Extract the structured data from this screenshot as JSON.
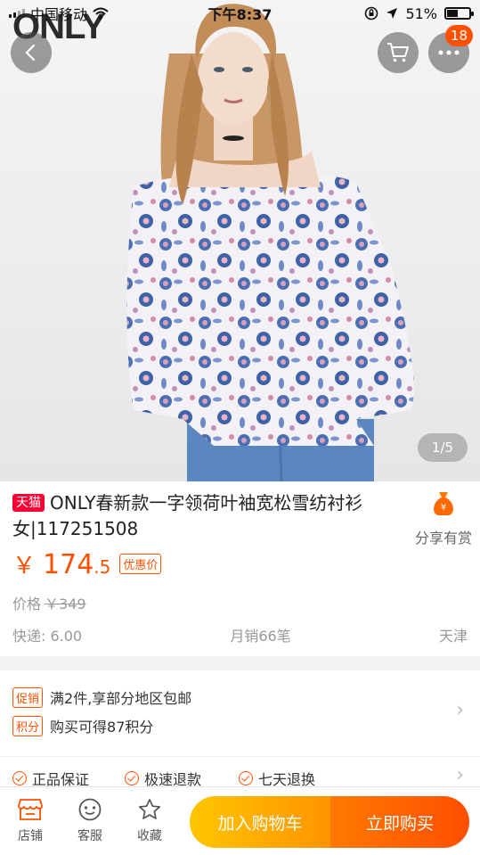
{
  "status_bar": {
    "carrier": "中国移动",
    "time": "下午8:37",
    "battery": "51%",
    "battery_level": 0.51
  },
  "hero": {
    "brand_logo": "ONLY",
    "page_indicator": "1/5",
    "cart_badge": "18"
  },
  "product": {
    "store_tag": "天猫",
    "title": "ONLY春新款一字领荷叶袖宽松雪纺衬衫女|117251508",
    "share_label": "分享有赏",
    "price_currency": "￥",
    "price_integer": "174",
    "price_decimal": ".5",
    "price_tag": "优惠价",
    "original_label": "价格",
    "original_price": "￥349",
    "shipping": "快递: 6.00",
    "monthly_sales": "月销66笔",
    "location": "天津"
  },
  "promotions": [
    {
      "tag": "促销",
      "text": "满2件,享部分地区包邮"
    },
    {
      "tag": "积分",
      "text": "购买可得87积分"
    }
  ],
  "guarantees": [
    "正品保证",
    "极速退款",
    "七天退换"
  ],
  "bottom_bar": {
    "tabs": [
      {
        "label": "店铺",
        "icon": "store-icon"
      },
      {
        "label": "客服",
        "icon": "customer-service-icon"
      },
      {
        "label": "收藏",
        "icon": "star-icon"
      }
    ],
    "add_to_cart": "加入购物车",
    "buy_now": "立即购买"
  },
  "colors": {
    "accent": "#ff5000",
    "tmall_red": "#ff0036",
    "cart_button": "#ffa800",
    "buy_button": "#ff5a00"
  }
}
